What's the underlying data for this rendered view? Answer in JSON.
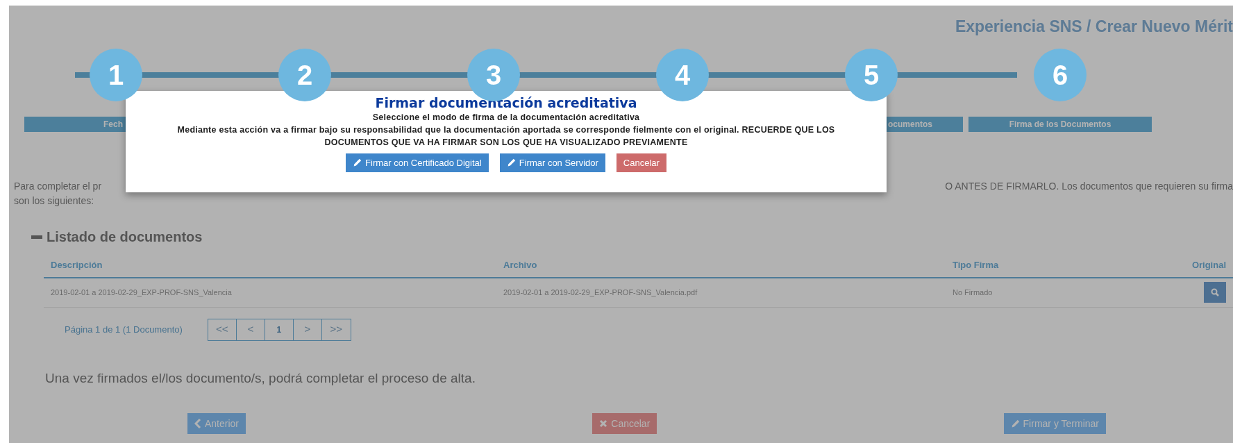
{
  "header": {
    "title": "Experiencia SNS / Crear Nuevo Mérit"
  },
  "steps": [
    {
      "number": "1",
      "label": "Fech"
    },
    {
      "number": "2"
    },
    {
      "number": "3"
    },
    {
      "number": "4"
    },
    {
      "number": "5",
      "label": "ocumentos"
    },
    {
      "number": "6",
      "label": "Firma de los Documentos"
    }
  ],
  "intro": {
    "left": "Para completar el pr",
    "right": "O ANTES DE FIRMARLO. Los documentos que requieren su firma",
    "line2": "son los siguientes:"
  },
  "documents": {
    "title": "Listado de documentos",
    "expanded": true,
    "columns": [
      "Descripción",
      "Archivo",
      "Tipo Firma",
      "Original"
    ],
    "rows": [
      {
        "description": "2019-02-01 a 2019-02-29_EXP-PROF-SNS_Valencia",
        "file": "2019-02-01 a 2019-02-29_EXP-PROF-SNS_Valencia.pdf",
        "signature": "No Firmado"
      }
    ],
    "pagination": {
      "summary": "Página 1 de 1 (1 Documento)",
      "pages": [
        {
          "label": "<<",
          "disabled": true,
          "selected": false
        },
        {
          "label": "<",
          "disabled": true,
          "selected": false
        },
        {
          "label": "1",
          "disabled": false,
          "selected": true
        },
        {
          "label": ">",
          "disabled": true,
          "selected": false
        },
        {
          "label": ">>",
          "disabled": true,
          "selected": false
        }
      ]
    }
  },
  "note": "Una vez firmados el/los documento/s, podrá completar el proceso de alta.",
  "footer_buttons": [
    {
      "label": "Anterior",
      "kind": "back"
    },
    {
      "label": "Cancelar",
      "kind": "cancel"
    },
    {
      "label": "Firmar y Terminar",
      "kind": "sign"
    }
  ],
  "modal": {
    "title": "Firmar documentación acreditativa",
    "subtitle": "Seleccione el modo de firma de la documentación acreditativa",
    "message": "Mediante esta acción va a firmar bajo su responsabilidad que la documentación aportada se corresponde fielmente con el original. RECUERDE QUE LOS DOCUMENTOS QUE VA HA FIRMAR SON LOS QUE HA VISUALIZADO PREVIAMENTE",
    "buttons": [
      {
        "label": "Firmar con Certificado Digital",
        "kind": "sign"
      },
      {
        "label": "Firmar con Servidor",
        "kind": "sign"
      },
      {
        "label": "Cancelar",
        "kind": "cancel"
      }
    ]
  }
}
